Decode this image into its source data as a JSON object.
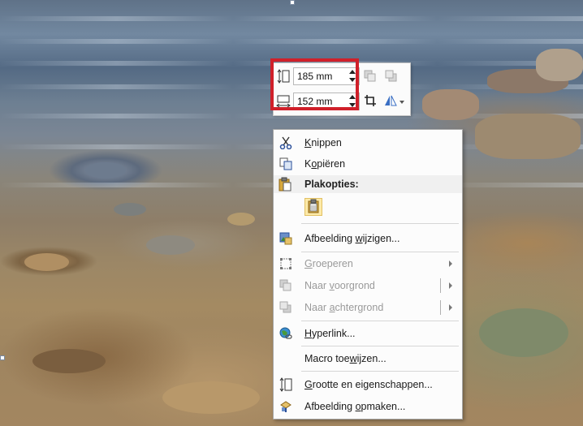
{
  "mini_toolbar": {
    "height_value": "185 mm",
    "width_value": "152 mm"
  },
  "context_menu": {
    "cut": {
      "pre": "",
      "key": "K",
      "post": "nippen"
    },
    "copy": {
      "pre": "K",
      "key": "o",
      "post": "piëren"
    },
    "paste_options_header": "Plakopties:",
    "change_picture": {
      "pre": "Afbeelding ",
      "key": "w",
      "post": "ijzigen..."
    },
    "group": {
      "pre": "",
      "key": "G",
      "post": "roeperen"
    },
    "bring_forward": {
      "pre": "Naar ",
      "key": "v",
      "post": "oorgrond"
    },
    "send_backward": {
      "pre": "Naar ",
      "key": "a",
      "post": "chtergrond"
    },
    "hyperlink": {
      "pre": "",
      "key": "H",
      "post": "yperlink..."
    },
    "assign_macro": {
      "pre": "Macro toe",
      "key": "w",
      "post": "ijzen..."
    },
    "size_properties": {
      "pre": "",
      "key": "G",
      "post": "rootte en eigenschappen..."
    },
    "format_picture": {
      "pre": "Afbeelding ",
      "key": "o",
      "post": "pmaken..."
    }
  },
  "colors": {
    "highlight_box": "#d0202a",
    "menu_background": "#fcfcfc",
    "disabled_text": "#9a9a9a"
  }
}
